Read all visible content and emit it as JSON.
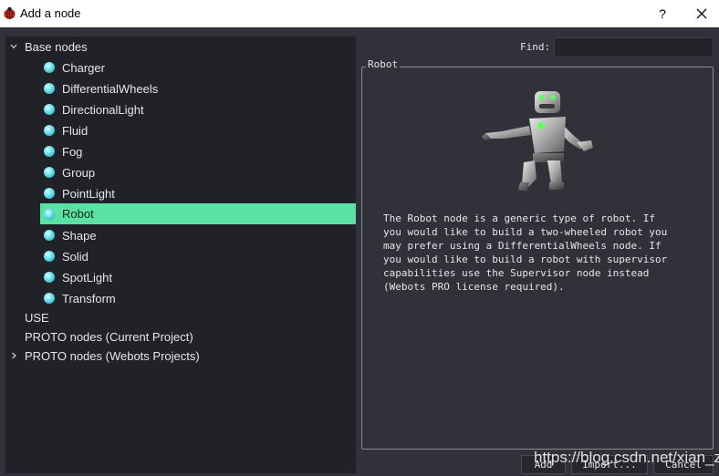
{
  "window": {
    "title": "Add a node",
    "help_label": "?",
    "app_icon": "ladybug-icon",
    "close_icon": "close-icon"
  },
  "tree": {
    "base_nodes_label": "Base nodes",
    "items": [
      {
        "label": "Charger"
      },
      {
        "label": "DifferentialWheels"
      },
      {
        "label": "DirectionalLight"
      },
      {
        "label": "Fluid"
      },
      {
        "label": "Fog"
      },
      {
        "label": "Group"
      },
      {
        "label": "PointLight"
      },
      {
        "label": "Robot",
        "selected": true
      },
      {
        "label": "Shape"
      },
      {
        "label": "Solid"
      },
      {
        "label": "SpotLight"
      },
      {
        "label": "Transform"
      }
    ],
    "use_label": "USE",
    "proto_current_label": "PROTO nodes (Current Project)",
    "proto_webots_label": "PROTO nodes (Webots Projects)",
    "selected_color": "#5be1a4"
  },
  "find": {
    "label": "Find:",
    "value": ""
  },
  "info": {
    "group_title": "Robot",
    "description": "The Robot node is a generic type of robot. If\nyou would like to build a two-wheeled robot you\nmay prefer using a DifferentialWheels node. If\nyou would like to build a robot with supervisor\ncapabilities use the Supervisor node instead\n(Webots PRO license required)."
  },
  "buttons": {
    "add": "Add",
    "import": "Import...",
    "cancel": "Cancel"
  },
  "watermark": "https://blog.csdn.net/xian_z"
}
